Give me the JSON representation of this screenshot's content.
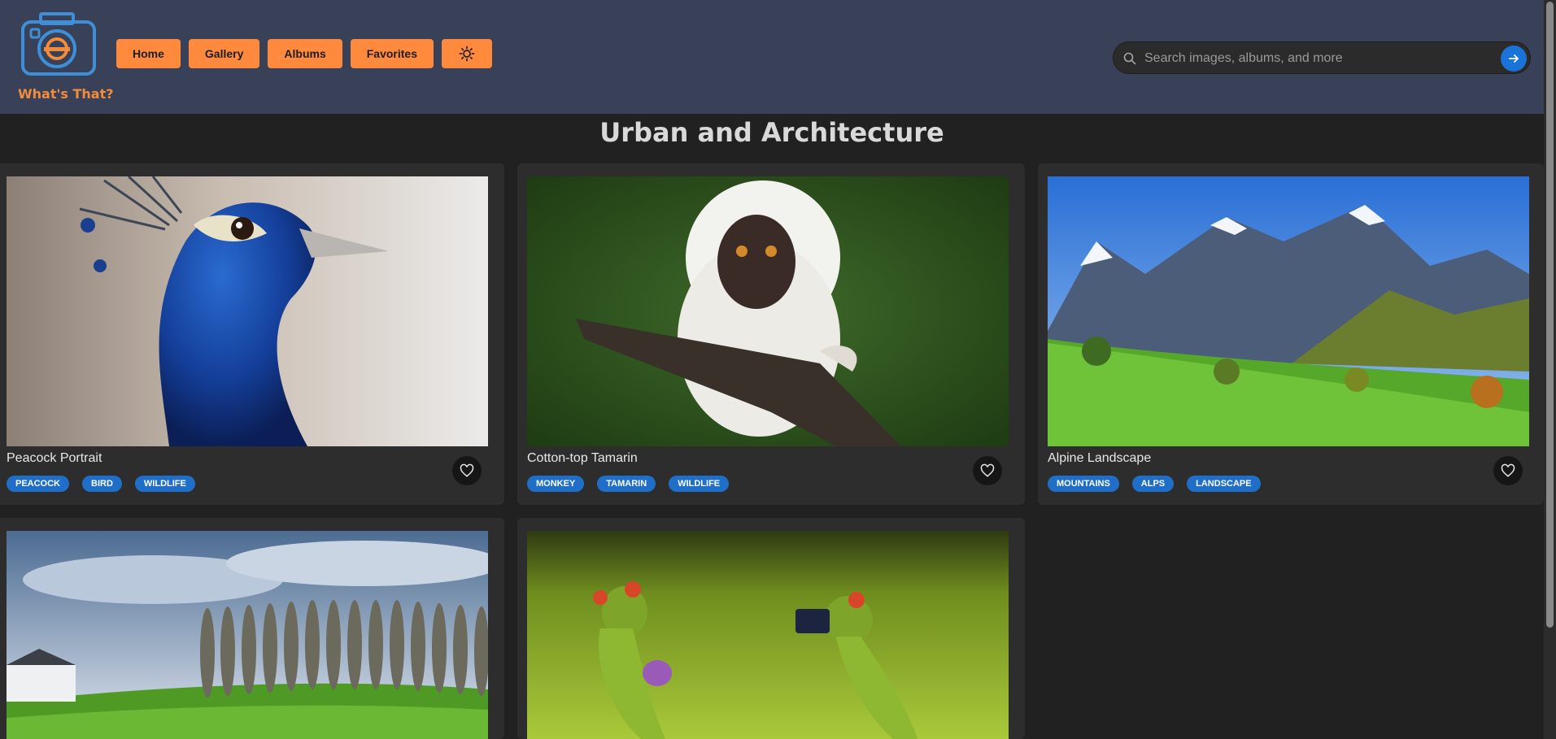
{
  "app": {
    "logo_text": "What's That?"
  },
  "nav": {
    "home": "Home",
    "gallery": "Gallery",
    "albums": "Albums",
    "favorites": "Favorites",
    "theme_icon": "sun-icon"
  },
  "search": {
    "placeholder": "Search images, albums, and more",
    "value": ""
  },
  "page": {
    "title": "Urban and Architecture"
  },
  "cards": [
    {
      "title": "Peacock Portrait",
      "tags": [
        "PEACOCK",
        "BIRD",
        "WILDLIFE"
      ]
    },
    {
      "title": "Cotton-top Tamarin",
      "tags": [
        "MONKEY",
        "TAMARIN",
        "WILDLIFE"
      ]
    },
    {
      "title": "Alpine Landscape",
      "tags": [
        "MOUNTAINS",
        "ALPS",
        "LANDSCAPE"
      ]
    },
    {
      "title": "",
      "tags": []
    },
    {
      "title": "",
      "tags": []
    }
  ],
  "colors": {
    "header": "#384157",
    "accent": "#ff8a3d",
    "tag": "#1f6fc9",
    "background": "#212121",
    "card": "#2d2d2d"
  }
}
